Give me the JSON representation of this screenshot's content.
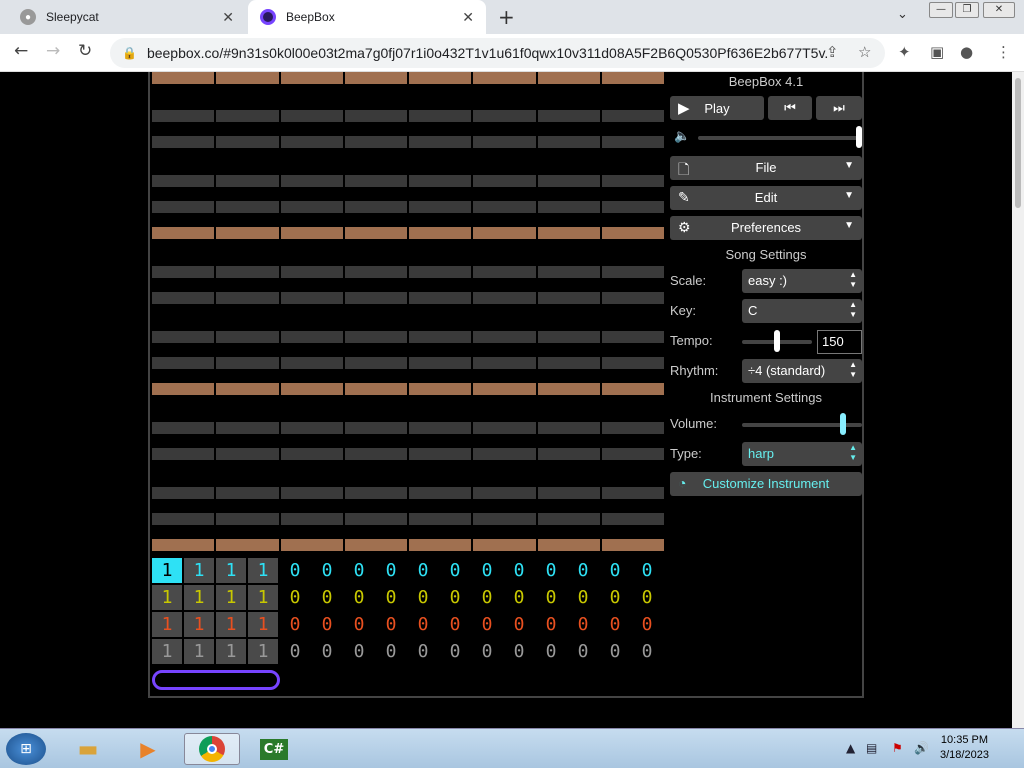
{
  "browser": {
    "tabs": [
      {
        "title": "Sleepycat"
      },
      {
        "title": "BeepBox"
      }
    ],
    "url": "beepbox.co/#9n31s0k0l00e03t2ma7g0fj07r1i0o432T1v1u61f0qwx10v311d08A5F2B6Q0530Pf636E2b677T5v..."
  },
  "app": {
    "title": "BeepBox 4.1",
    "play_label": "Play",
    "menus": {
      "file": "File",
      "edit": "Edit",
      "preferences": "Preferences"
    },
    "song_settings_title": "Song Settings",
    "scale": {
      "label": "Scale:",
      "value": "easy :)"
    },
    "key": {
      "label": "Key:",
      "value": "C"
    },
    "tempo": {
      "label": "Tempo:",
      "value": "150"
    },
    "rhythm": {
      "label": "Rhythm:",
      "value": "÷4 (standard)"
    },
    "instrument_settings_title": "Instrument Settings",
    "volume": {
      "label": "Volume:"
    },
    "type": {
      "label": "Type:",
      "value": "harp"
    },
    "customize_label": "Customize Instrument"
  },
  "pattern_rows": [
    {
      "c": "#2ee1f5",
      "v": [
        "1",
        "1",
        "1",
        "1",
        "0",
        "0",
        "0",
        "0",
        "0",
        "0",
        "0",
        "0",
        "0",
        "0",
        "0",
        "0"
      ]
    },
    {
      "c": "#c8c800",
      "v": [
        "1",
        "1",
        "1",
        "1",
        "0",
        "0",
        "0",
        "0",
        "0",
        "0",
        "0",
        "0",
        "0",
        "0",
        "0",
        "0"
      ]
    },
    {
      "c": "#e85020",
      "v": [
        "1",
        "1",
        "1",
        "1",
        "0",
        "0",
        "0",
        "0",
        "0",
        "0",
        "0",
        "0",
        "0",
        "0",
        "0",
        "0"
      ]
    },
    {
      "c": "#999999",
      "v": [
        "1",
        "1",
        "1",
        "1",
        "0",
        "0",
        "0",
        "0",
        "0",
        "0",
        "0",
        "0",
        "0",
        "0",
        "0",
        "0"
      ]
    }
  ],
  "taskbar": {
    "time": "10:35 PM",
    "date": "3/18/2023"
  }
}
